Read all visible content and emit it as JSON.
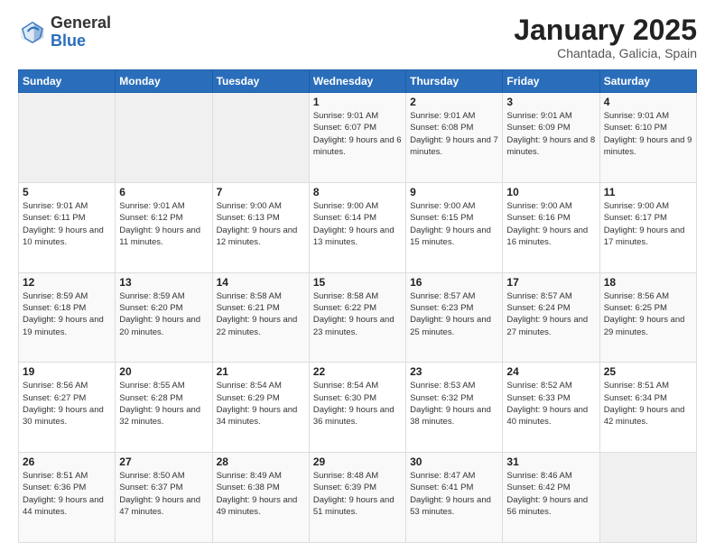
{
  "header": {
    "logo_general": "General",
    "logo_blue": "Blue",
    "title": "January 2025",
    "subtitle": "Chantada, Galicia, Spain"
  },
  "days_of_week": [
    "Sunday",
    "Monday",
    "Tuesday",
    "Wednesday",
    "Thursday",
    "Friday",
    "Saturday"
  ],
  "weeks": [
    [
      {
        "day": "",
        "info": ""
      },
      {
        "day": "",
        "info": ""
      },
      {
        "day": "",
        "info": ""
      },
      {
        "day": "1",
        "info": "Sunrise: 9:01 AM\nSunset: 6:07 PM\nDaylight: 9 hours and 6 minutes."
      },
      {
        "day": "2",
        "info": "Sunrise: 9:01 AM\nSunset: 6:08 PM\nDaylight: 9 hours and 7 minutes."
      },
      {
        "day": "3",
        "info": "Sunrise: 9:01 AM\nSunset: 6:09 PM\nDaylight: 9 hours and 8 minutes."
      },
      {
        "day": "4",
        "info": "Sunrise: 9:01 AM\nSunset: 6:10 PM\nDaylight: 9 hours and 9 minutes."
      }
    ],
    [
      {
        "day": "5",
        "info": "Sunrise: 9:01 AM\nSunset: 6:11 PM\nDaylight: 9 hours and 10 minutes."
      },
      {
        "day": "6",
        "info": "Sunrise: 9:01 AM\nSunset: 6:12 PM\nDaylight: 9 hours and 11 minutes."
      },
      {
        "day": "7",
        "info": "Sunrise: 9:00 AM\nSunset: 6:13 PM\nDaylight: 9 hours and 12 minutes."
      },
      {
        "day": "8",
        "info": "Sunrise: 9:00 AM\nSunset: 6:14 PM\nDaylight: 9 hours and 13 minutes."
      },
      {
        "day": "9",
        "info": "Sunrise: 9:00 AM\nSunset: 6:15 PM\nDaylight: 9 hours and 15 minutes."
      },
      {
        "day": "10",
        "info": "Sunrise: 9:00 AM\nSunset: 6:16 PM\nDaylight: 9 hours and 16 minutes."
      },
      {
        "day": "11",
        "info": "Sunrise: 9:00 AM\nSunset: 6:17 PM\nDaylight: 9 hours and 17 minutes."
      }
    ],
    [
      {
        "day": "12",
        "info": "Sunrise: 8:59 AM\nSunset: 6:18 PM\nDaylight: 9 hours and 19 minutes."
      },
      {
        "day": "13",
        "info": "Sunrise: 8:59 AM\nSunset: 6:20 PM\nDaylight: 9 hours and 20 minutes."
      },
      {
        "day": "14",
        "info": "Sunrise: 8:58 AM\nSunset: 6:21 PM\nDaylight: 9 hours and 22 minutes."
      },
      {
        "day": "15",
        "info": "Sunrise: 8:58 AM\nSunset: 6:22 PM\nDaylight: 9 hours and 23 minutes."
      },
      {
        "day": "16",
        "info": "Sunrise: 8:57 AM\nSunset: 6:23 PM\nDaylight: 9 hours and 25 minutes."
      },
      {
        "day": "17",
        "info": "Sunrise: 8:57 AM\nSunset: 6:24 PM\nDaylight: 9 hours and 27 minutes."
      },
      {
        "day": "18",
        "info": "Sunrise: 8:56 AM\nSunset: 6:25 PM\nDaylight: 9 hours and 29 minutes."
      }
    ],
    [
      {
        "day": "19",
        "info": "Sunrise: 8:56 AM\nSunset: 6:27 PM\nDaylight: 9 hours and 30 minutes."
      },
      {
        "day": "20",
        "info": "Sunrise: 8:55 AM\nSunset: 6:28 PM\nDaylight: 9 hours and 32 minutes."
      },
      {
        "day": "21",
        "info": "Sunrise: 8:54 AM\nSunset: 6:29 PM\nDaylight: 9 hours and 34 minutes."
      },
      {
        "day": "22",
        "info": "Sunrise: 8:54 AM\nSunset: 6:30 PM\nDaylight: 9 hours and 36 minutes."
      },
      {
        "day": "23",
        "info": "Sunrise: 8:53 AM\nSunset: 6:32 PM\nDaylight: 9 hours and 38 minutes."
      },
      {
        "day": "24",
        "info": "Sunrise: 8:52 AM\nSunset: 6:33 PM\nDaylight: 9 hours and 40 minutes."
      },
      {
        "day": "25",
        "info": "Sunrise: 8:51 AM\nSunset: 6:34 PM\nDaylight: 9 hours and 42 minutes."
      }
    ],
    [
      {
        "day": "26",
        "info": "Sunrise: 8:51 AM\nSunset: 6:36 PM\nDaylight: 9 hours and 44 minutes."
      },
      {
        "day": "27",
        "info": "Sunrise: 8:50 AM\nSunset: 6:37 PM\nDaylight: 9 hours and 47 minutes."
      },
      {
        "day": "28",
        "info": "Sunrise: 8:49 AM\nSunset: 6:38 PM\nDaylight: 9 hours and 49 minutes."
      },
      {
        "day": "29",
        "info": "Sunrise: 8:48 AM\nSunset: 6:39 PM\nDaylight: 9 hours and 51 minutes."
      },
      {
        "day": "30",
        "info": "Sunrise: 8:47 AM\nSunset: 6:41 PM\nDaylight: 9 hours and 53 minutes."
      },
      {
        "day": "31",
        "info": "Sunrise: 8:46 AM\nSunset: 6:42 PM\nDaylight: 9 hours and 56 minutes."
      },
      {
        "day": "",
        "info": ""
      }
    ]
  ]
}
